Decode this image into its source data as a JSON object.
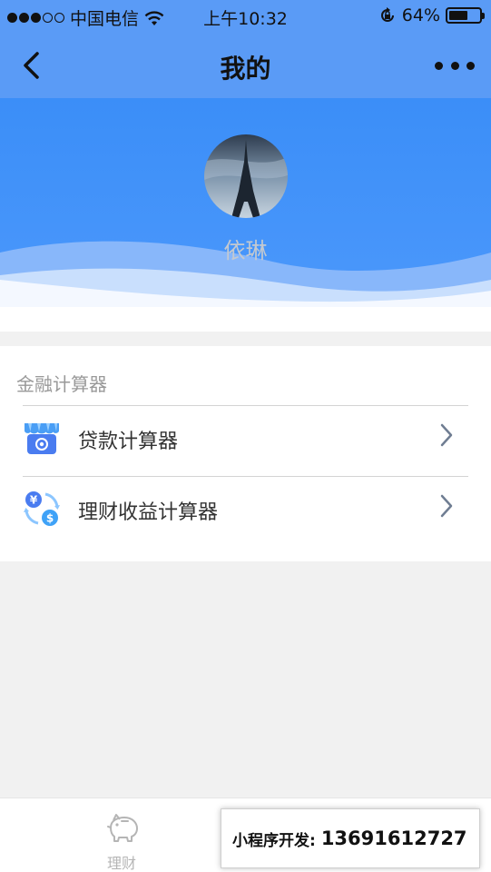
{
  "status_bar": {
    "carrier": "中国电信",
    "time": "上午10:32",
    "battery_percent": "64%",
    "battery_level": 0.64
  },
  "nav": {
    "title": "我的",
    "back_icon": "chevron-left-icon",
    "more_icon": "more-dots-icon"
  },
  "profile": {
    "username": "依琳",
    "avatar_icon": "eiffel-tower-photo"
  },
  "calculator_section": {
    "title": "金融计算器",
    "items": [
      {
        "label": "贷款计算器",
        "icon": "shop-icon"
      },
      {
        "label": "理财收益计算器",
        "icon": "currency-exchange-icon"
      }
    ]
  },
  "tab_bar": {
    "tabs": [
      {
        "label": "理财",
        "icon": "piggy-bank-icon"
      }
    ]
  },
  "promo": {
    "label": "小程序开发:",
    "phone": "13691612727"
  },
  "colors": {
    "primary": "#5a9bf6",
    "header_gradient_top": "#3b8ef8",
    "background": "#f1f1f1"
  }
}
